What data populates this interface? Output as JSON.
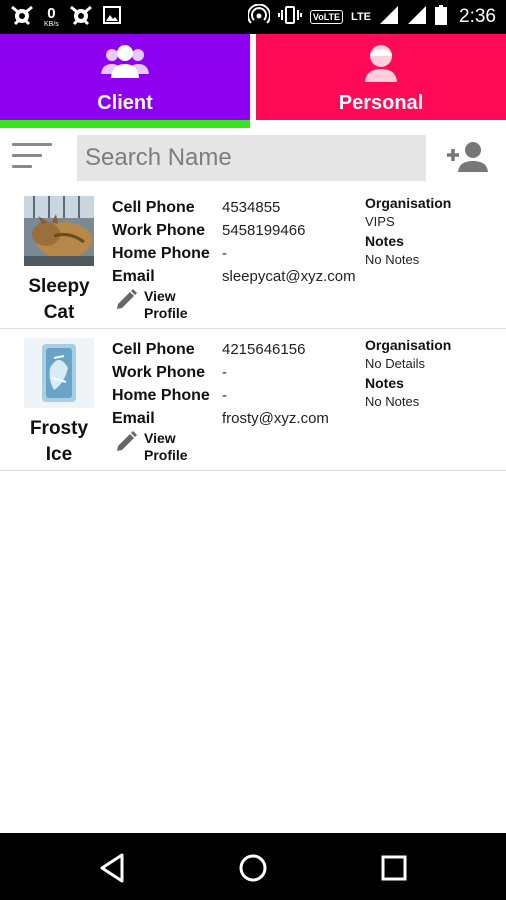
{
  "status_bar": {
    "net_speed_value": "0",
    "net_speed_unit": "KB/s",
    "volte": "VoLTE",
    "lte": "LTE",
    "time": "2:36"
  },
  "tabs": [
    {
      "label": "Client",
      "icon": "group-icon",
      "color": "#8e00f0",
      "selected": true
    },
    {
      "label": "Personal",
      "icon": "person-icon",
      "color": "#ff0a57",
      "selected": false
    }
  ],
  "accent": {
    "indicator": "#39e51f"
  },
  "search": {
    "placeholder": "Search Name",
    "value": ""
  },
  "field_labels": {
    "cell": "Cell Phone",
    "work": "Work Phone",
    "home": "Home Phone",
    "email": "Email",
    "organisation": "Organisation",
    "notes": "Notes",
    "view_profile_line1": "View",
    "view_profile_line2": "Profile"
  },
  "contacts": [
    {
      "name_line1": "Sleepy",
      "name_line2": "Cat",
      "avatar": "cat-photo",
      "cell_phone": "4534855",
      "work_phone": "5458199466",
      "home_phone": "-",
      "email": "sleepycat@xyz.com",
      "organisation": "VIPS",
      "notes": "No Notes"
    },
    {
      "name_line1": "Frosty",
      "name_line2": "Ice",
      "avatar": "ice-photo",
      "cell_phone": "4215646156",
      "work_phone": "-",
      "home_phone": "-",
      "email": "frosty@xyz.com",
      "organisation": "No Details",
      "notes": "No Notes"
    }
  ],
  "nav_bar": {
    "buttons": [
      "back-icon",
      "home-icon",
      "recents-icon"
    ]
  }
}
